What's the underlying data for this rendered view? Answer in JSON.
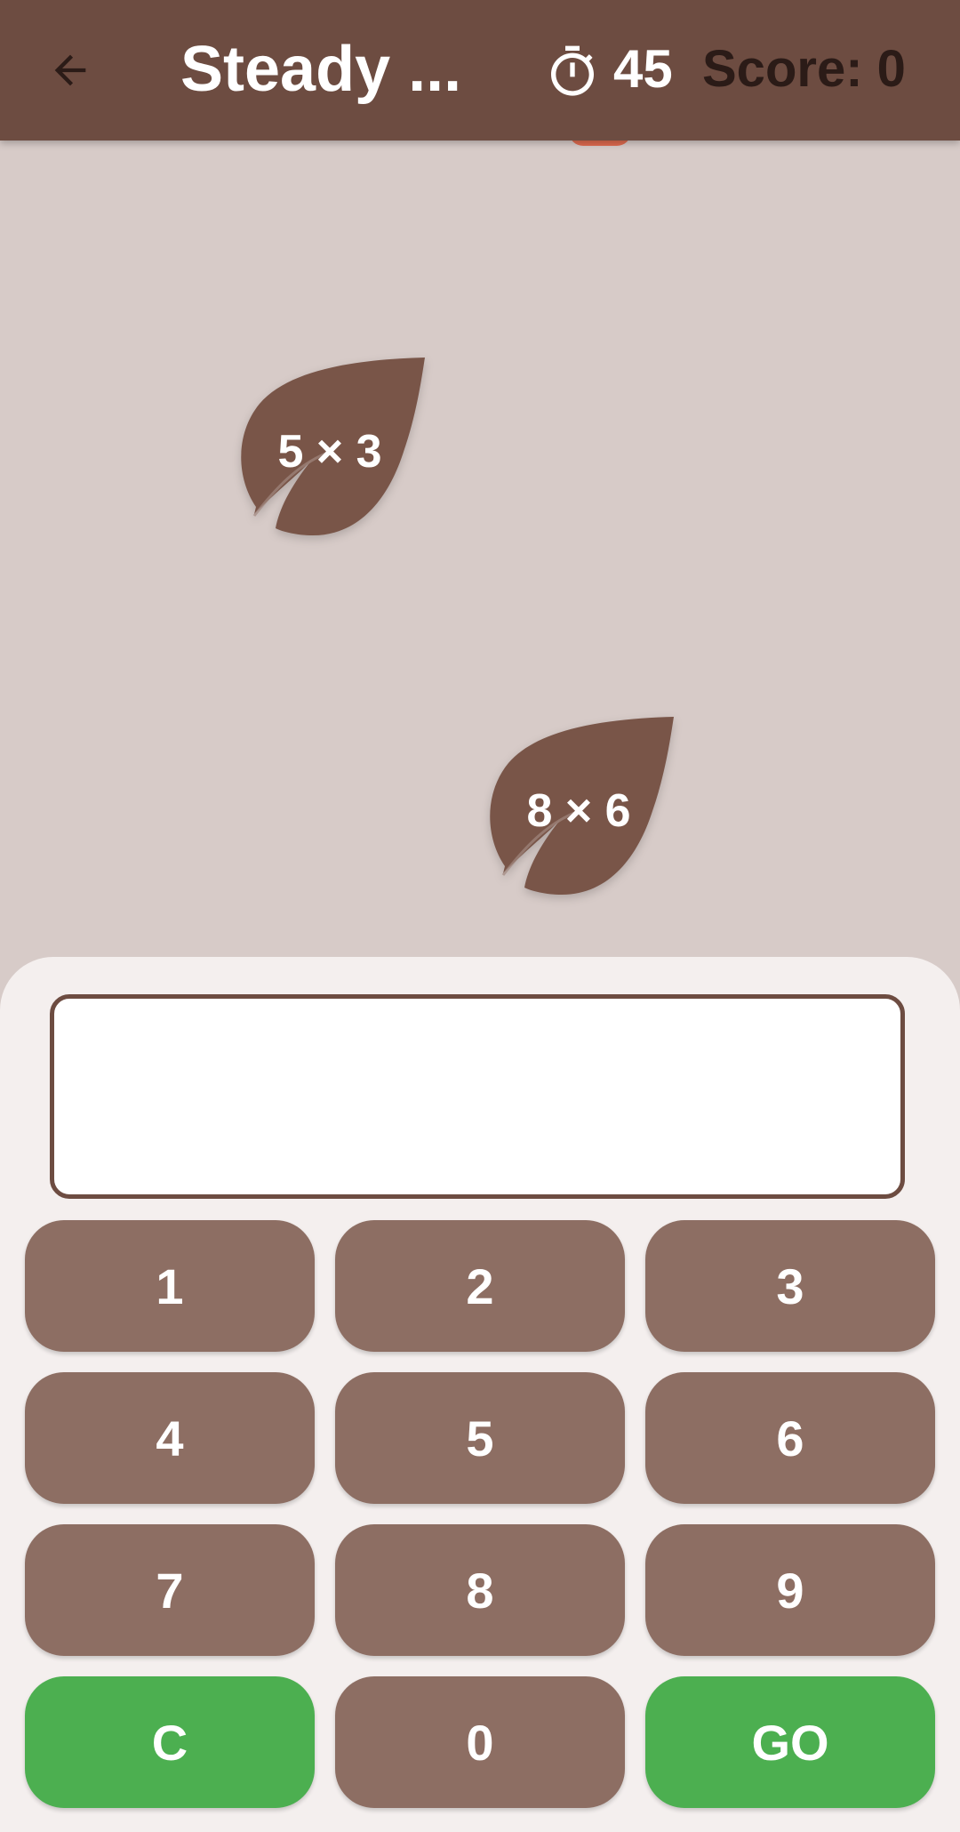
{
  "header": {
    "title": "Steady ...",
    "timer_value": "45",
    "score_label": "Score: 0"
  },
  "icons": {
    "back": "arrow-left-icon",
    "timer": "stopwatch-icon"
  },
  "leaves": [
    {
      "expression": "5 × 3"
    },
    {
      "expression": "8 × 6"
    }
  ],
  "answer": {
    "value": ""
  },
  "keypad": {
    "keys": [
      "1",
      "2",
      "3",
      "4",
      "5",
      "6",
      "7",
      "8",
      "9",
      "C",
      "0",
      "GO"
    ]
  },
  "colors": {
    "app_bar": "#6d4c41",
    "background": "#d7cbc8",
    "leaf": "#795548",
    "key": "#8d6e63",
    "key_action": "#4caf50",
    "panel": "#f4efee"
  }
}
